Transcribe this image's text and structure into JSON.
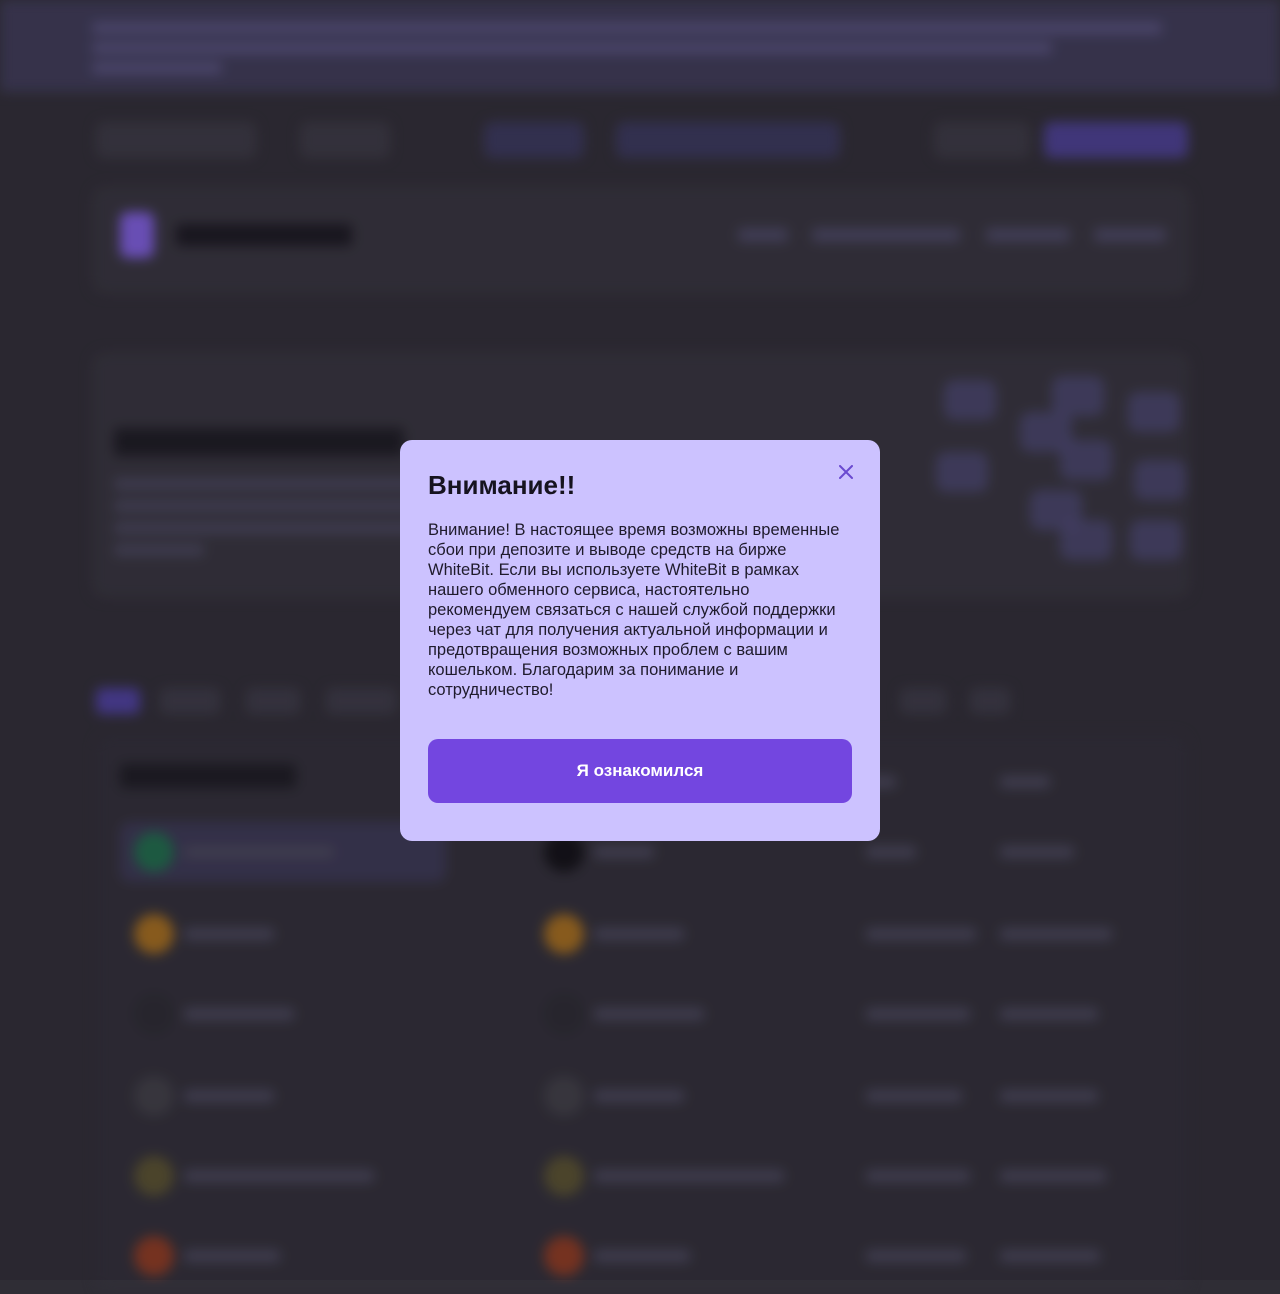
{
  "modal": {
    "title": "Внимание!!",
    "message": "Внимание! В настоящее время возможны временные сбои при депозите и выводе средств на бирже WhiteBit. Если вы используете WhiteBit в рамках нашего обменного сервиса, настоятельно рекомендуем связаться с нашей службой поддержки через чат для получения актуальной информации и предотвращения возможных проблем с вашим кошельком. Благодарим за понимание и сотрудничество!",
    "confirm_label": "Я ознакомился",
    "close_icon": "close-icon"
  },
  "colors": {
    "modal_bg": "#ccc2ff",
    "button_bg": "#7346e0",
    "page_bg": "#2f2d35",
    "accent": "#7b5cd6"
  }
}
